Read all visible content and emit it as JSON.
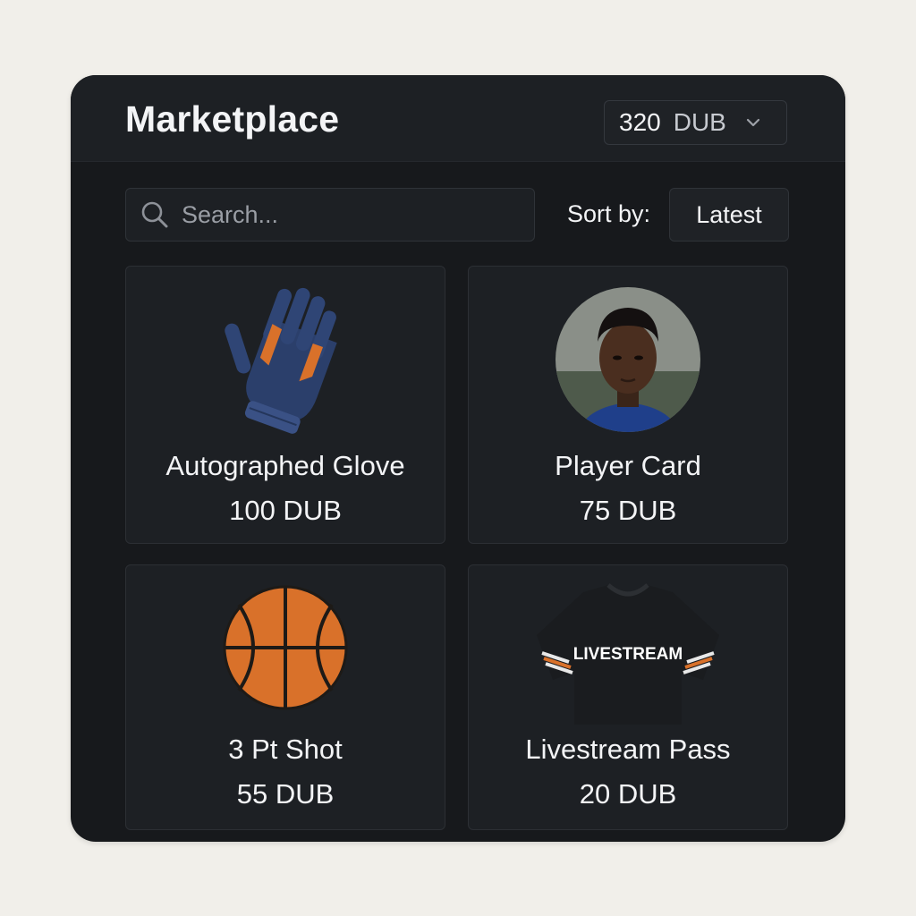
{
  "header": {
    "title": "Marketplace",
    "balance_amount": "320",
    "balance_currency": "DUB"
  },
  "toolbar": {
    "search_placeholder": "Search...",
    "sort_label": "Sort by:",
    "sort_value": "Latest"
  },
  "items": [
    {
      "name": "Autographed Glove",
      "price": "100 DUB",
      "icon": "glove-image"
    },
    {
      "name": "Player Card",
      "price": "75 DUB",
      "icon": "player-portrait"
    },
    {
      "name": "3 Pt Shot",
      "price": "55 DUB",
      "icon": "basketball-image"
    },
    {
      "name": "Livestream Pass",
      "price": "20 DUB",
      "icon": "jersey-image",
      "jersey_text": "LIVESTREAM"
    }
  ],
  "colors": {
    "background": "#f1efea",
    "panel": "#17191c",
    "card": "#1d2024",
    "accent_orange": "#d9712a",
    "glove_navy": "#2b3f6b"
  }
}
